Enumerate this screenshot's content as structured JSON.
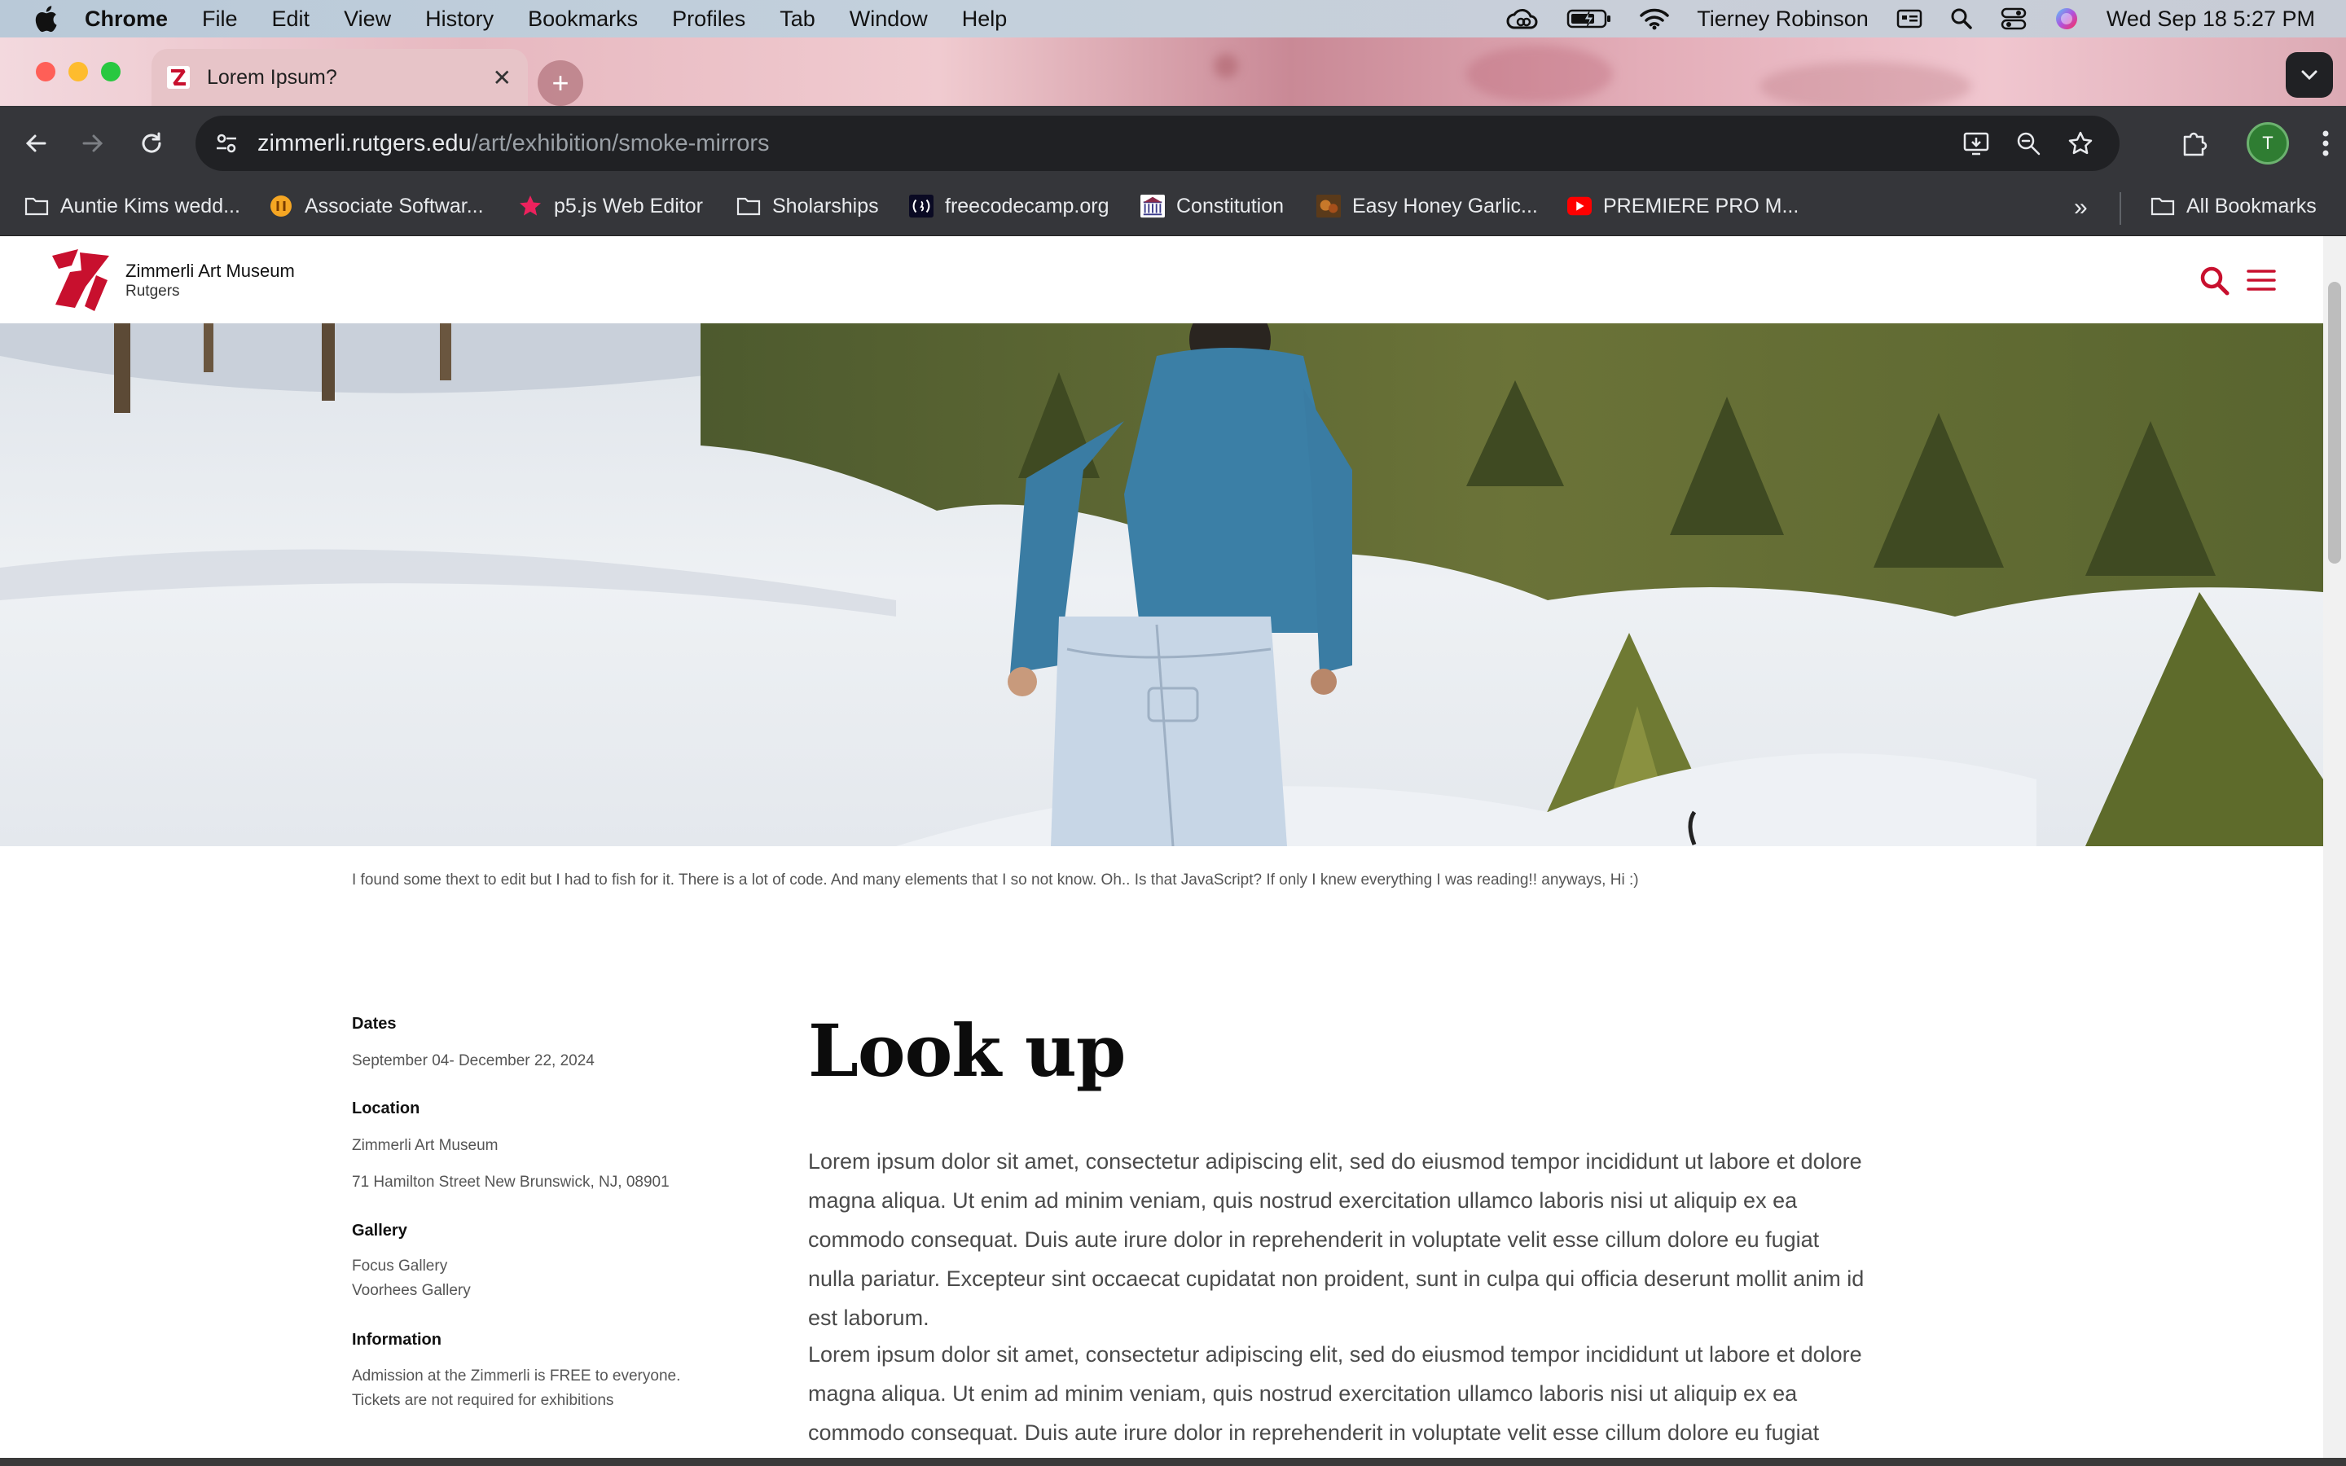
{
  "menubar": {
    "app": "Chrome",
    "items": [
      "File",
      "Edit",
      "View",
      "History",
      "Bookmarks",
      "Profiles",
      "Tab",
      "Window",
      "Help"
    ],
    "user": "Tierney Robinson",
    "clock": "Wed Sep 18  5:27 PM"
  },
  "tab": {
    "title": "Lorem Ipsum?"
  },
  "omnibox": {
    "host": "zimmerli.rutgers.edu",
    "path": "/art/exhibition/smoke-mirrors"
  },
  "profile": {
    "initial": "T"
  },
  "bookmarks": {
    "items": [
      {
        "label": "Auntie Kims wedd...",
        "icon": "folder-icon"
      },
      {
        "label": "Associate Softwar...",
        "icon": "orange-circle-icon"
      },
      {
        "label": "p5.js Web Editor",
        "icon": "pink-star-icon"
      },
      {
        "label": "Sholarships",
        "icon": "folder-icon"
      },
      {
        "label": "freecodecamp.org",
        "icon": "freecodecamp-icon"
      },
      {
        "label": "Constitution",
        "icon": "constitution-icon"
      },
      {
        "label": "Easy Honey Garlic...",
        "icon": "recipe-thumbnail-icon"
      },
      {
        "label": "PREMIERE PRO M...",
        "icon": "youtube-icon"
      }
    ],
    "overflow": "»",
    "all": "All Bookmarks"
  },
  "site": {
    "name": "Zimmerli Art Museum",
    "sub": "Rutgers",
    "accent": "#c8102e"
  },
  "page": {
    "caption": "I found some thext to edit but I had to fish for it. There is a lot of code. And many elements that I so not know. Oh.. Is that JavaScript? If only I knew everything I was reading!! anyways, Hi :)",
    "title": "Look up",
    "paragraphs": [
      "Lorem ipsum dolor sit amet, consectetur adipiscing elit, sed do eiusmod tempor incididunt ut labore et dolore magna aliqua. Ut enim ad minim veniam, quis nostrud exercitation ullamco laboris nisi ut aliquip ex ea commodo consequat. Duis aute irure dolor in reprehenderit in voluptate velit esse cillum dolore eu fugiat nulla pariatur. Excepteur sint occaecat cupidatat non proident, sunt in culpa qui officia deserunt mollit anim id est laborum.",
      "Lorem ipsum dolor sit amet, consectetur adipiscing elit, sed do eiusmod tempor incididunt ut labore et dolore magna aliqua. Ut enim ad minim veniam, quis nostrud exercitation ullamco laboris nisi ut aliquip ex ea commodo consequat. Duis aute irure dolor in reprehenderit in voluptate velit esse cillum dolore eu fugiat nulla pariatur."
    ]
  },
  "sidebar": {
    "dates_label": "Dates",
    "dates": "September 04- December 22, 2024",
    "location_label": "Location",
    "location_name": "Zimmerli Art Museum",
    "location_address": "71 Hamilton Street New Brunswick, NJ, 08901",
    "gallery_label": "Gallery",
    "galleries": [
      "Focus Gallery",
      "Voorhees Gallery"
    ],
    "info_label": "Information",
    "info_lines": [
      "Admission at the Zimmerli is FREE to everyone.",
      "Tickets are not required for exhibitions"
    ]
  }
}
